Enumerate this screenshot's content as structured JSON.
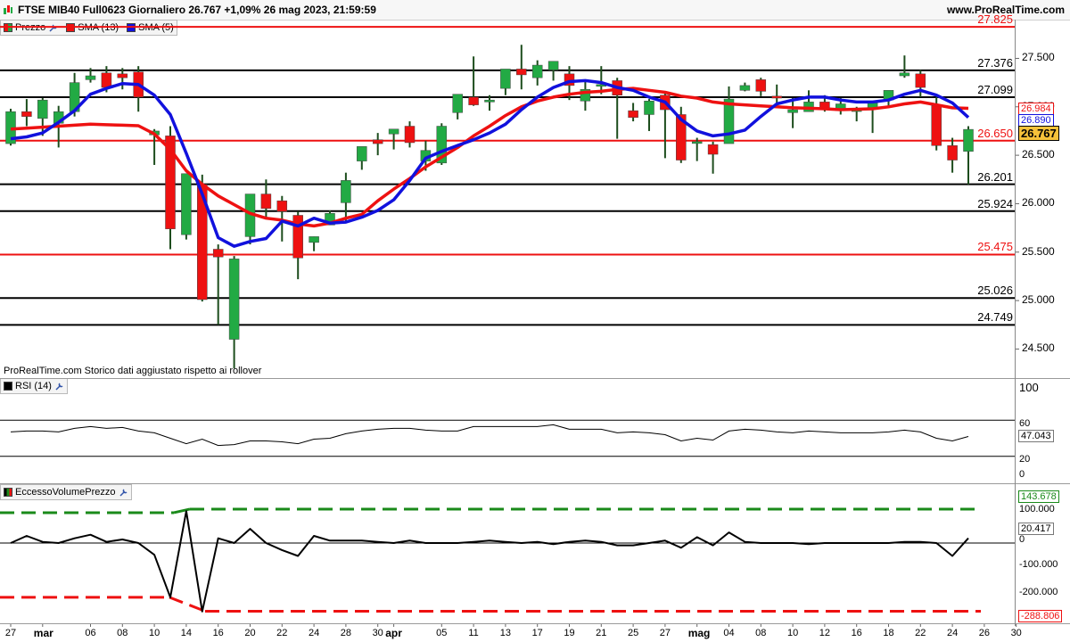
{
  "header": {
    "title": "FTSE MIB40 Full0623 Giornaliero 26.767 +1,09% 26 mag 2023, 21:59:59",
    "site": "www.ProRealTime.com"
  },
  "legend_price": {
    "prezzo": "Prezzo",
    "sma13": "SMA (13)",
    "sma5": "SMA (5)"
  },
  "note": "ProRealTime.com Storico dati aggiustato rispetto ai rollover",
  "rsi": {
    "label": "RSI (14)",
    "value_label": "47.043",
    "ticks": [
      "100",
      "60",
      "20",
      "0"
    ]
  },
  "evp": {
    "label": "EccessoVolumePrezzo",
    "upper_label": "143.678",
    "value_label": "20.417",
    "zero_label": "0",
    "lower_label": "-288.806",
    "ticks": [
      "100.000",
      "-100.000",
      "-200.000"
    ]
  },
  "colors": {
    "up": "#22aa44",
    "down": "#ee1111",
    "sma13": "#ee1111",
    "sma5": "#1111dd",
    "green_dash": "#1a8a1a",
    "red_dash": "#ee1111"
  },
  "chart_data": {
    "type": "candlestick",
    "price_axis": {
      "ylim": [
        24200,
        27900
      ],
      "ticks": [
        "27.500",
        "27.000",
        "26.500",
        "26.000",
        "25.500",
        "25.000",
        "24.500"
      ]
    },
    "levels": [
      {
        "value": 27825,
        "label": "27.825",
        "color": "#ee1111"
      },
      {
        "value": 27376,
        "label": "27.376",
        "color": "#000000"
      },
      {
        "value": 27099,
        "label": "27.099",
        "color": "#000000"
      },
      {
        "value": 26650,
        "label": "26.650",
        "color": "#ee1111"
      },
      {
        "value": 26201,
        "label": "26.201",
        "color": "#000000"
      },
      {
        "value": 25924,
        "label": "25.924",
        "color": "#000000"
      },
      {
        "value": 25475,
        "label": "25.475",
        "color": "#ee1111"
      },
      {
        "value": 25026,
        "label": "25.026",
        "color": "#000000"
      },
      {
        "value": 24749,
        "label": "24.749",
        "color": "#000000"
      }
    ],
    "last_price": {
      "value": 26767,
      "label": "26.767"
    },
    "sma13_last": {
      "value": 26984,
      "label": "26.984"
    },
    "sma5_last": {
      "value": 26890,
      "label": "26.890"
    },
    "x_labels": [
      {
        "label": "27",
        "i": 0,
        "bold": false
      },
      {
        "label": "mar",
        "i": 2,
        "bold": true
      },
      {
        "label": "06",
        "i": 5,
        "bold": false
      },
      {
        "label": "08",
        "i": 7,
        "bold": false
      },
      {
        "label": "10",
        "i": 9,
        "bold": false
      },
      {
        "label": "14",
        "i": 11,
        "bold": false
      },
      {
        "label": "16",
        "i": 13,
        "bold": false
      },
      {
        "label": "20",
        "i": 15,
        "bold": false
      },
      {
        "label": "22",
        "i": 17,
        "bold": false
      },
      {
        "label": "24",
        "i": 19,
        "bold": false
      },
      {
        "label": "28",
        "i": 21,
        "bold": false
      },
      {
        "label": "30",
        "i": 23,
        "bold": false
      },
      {
        "label": "apr",
        "i": 24,
        "bold": true
      },
      {
        "label": "05",
        "i": 27,
        "bold": false
      },
      {
        "label": "11",
        "i": 29,
        "bold": false
      },
      {
        "label": "13",
        "i": 31,
        "bold": false
      },
      {
        "label": "17",
        "i": 33,
        "bold": false
      },
      {
        "label": "19",
        "i": 35,
        "bold": false
      },
      {
        "label": "21",
        "i": 37,
        "bold": false
      },
      {
        "label": "25",
        "i": 39,
        "bold": false
      },
      {
        "label": "27",
        "i": 41,
        "bold": false
      },
      {
        "label": "mag",
        "i": 43,
        "bold": true
      },
      {
        "label": "04",
        "i": 45,
        "bold": false
      },
      {
        "label": "08",
        "i": 47,
        "bold": false
      },
      {
        "label": "10",
        "i": 49,
        "bold": false
      },
      {
        "label": "12",
        "i": 51,
        "bold": false
      },
      {
        "label": "16",
        "i": 53,
        "bold": false
      },
      {
        "label": "18",
        "i": 55,
        "bold": false
      },
      {
        "label": "22",
        "i": 57,
        "bold": false
      },
      {
        "label": "24",
        "i": 59,
        "bold": false
      },
      {
        "label": "26",
        "i": 61,
        "bold": false
      },
      {
        "label": "30",
        "i": 63,
        "bold": false
      }
    ],
    "candles": [
      [
        26620,
        26980,
        26600,
        26950
      ],
      [
        26950,
        27080,
        26800,
        26900
      ],
      [
        26880,
        27090,
        26700,
        27070
      ],
      [
        26830,
        27010,
        26580,
        26950
      ],
      [
        26950,
        27350,
        26900,
        27250
      ],
      [
        27280,
        27400,
        27250,
        27320
      ],
      [
        27350,
        27420,
        27150,
        27200
      ],
      [
        27340,
        27400,
        27180,
        27300
      ],
      [
        27360,
        27420,
        26950,
        27100
      ],
      [
        26710,
        26770,
        26400,
        26750
      ],
      [
        26700,
        26800,
        25530,
        25740
      ],
      [
        25680,
        26270,
        25630,
        26310
      ],
      [
        26200,
        26300,
        24990,
        25010
      ],
      [
        25530,
        25580,
        24750,
        25450
      ],
      [
        24600,
        25460,
        24300,
        25430
      ],
      [
        25660,
        26090,
        25580,
        26100
      ],
      [
        26100,
        26250,
        25850,
        25950
      ],
      [
        26030,
        26080,
        25610,
        25920
      ],
      [
        25880,
        25920,
        25220,
        25440
      ],
      [
        25600,
        25660,
        25510,
        25660
      ],
      [
        25780,
        25930,
        25780,
        25900
      ],
      [
        26010,
        26320,
        25820,
        26240
      ],
      [
        26440,
        26560,
        26350,
        26590
      ],
      [
        26660,
        26730,
        26500,
        26620
      ],
      [
        26720,
        26760,
        26560,
        26770
      ],
      [
        26800,
        26850,
        26580,
        26630
      ],
      [
        26440,
        26650,
        26340,
        26550
      ],
      [
        26420,
        26830,
        26400,
        26800
      ],
      [
        26940,
        27120,
        26870,
        27130
      ],
      [
        27100,
        27520,
        27010,
        27020
      ],
      [
        27050,
        27120,
        26960,
        27070
      ],
      [
        27190,
        27350,
        27120,
        27390
      ],
      [
        27390,
        27640,
        27180,
        27330
      ],
      [
        27300,
        27480,
        27220,
        27430
      ],
      [
        27380,
        27470,
        27270,
        27470
      ],
      [
        27340,
        27420,
        27070,
        27220
      ],
      [
        27060,
        27280,
        26960,
        27180
      ],
      [
        27220,
        27420,
        27130,
        27230
      ],
      [
        27270,
        27300,
        26670,
        27120
      ],
      [
        26960,
        27040,
        26850,
        26890
      ],
      [
        26920,
        27080,
        26750,
        27060
      ],
      [
        27120,
        27150,
        26470,
        26970
      ],
      [
        26920,
        27000,
        26420,
        26450
      ],
      [
        26640,
        26680,
        26440,
        26640
      ],
      [
        26610,
        26640,
        26310,
        26510
      ],
      [
        26620,
        27210,
        26630,
        27080
      ],
      [
        27170,
        27250,
        27160,
        27220
      ],
      [
        27280,
        27300,
        27110,
        27160
      ],
      [
        27110,
        27230,
        26990,
        27090
      ],
      [
        26940,
        27090,
        26780,
        26970
      ],
      [
        26950,
        27170,
        26950,
        27050
      ],
      [
        27050,
        27120,
        26950,
        26990
      ],
      [
        26960,
        27090,
        26920,
        27030
      ],
      [
        26960,
        27000,
        26850,
        26970
      ],
      [
        26980,
        27060,
        26730,
        27040
      ],
      [
        27070,
        27130,
        26990,
        27170
      ],
      [
        27320,
        27530,
        27300,
        27350
      ],
      [
        27340,
        27380,
        27100,
        27200
      ],
      [
        27010,
        27100,
        26550,
        26600
      ],
      [
        26600,
        26680,
        26320,
        26450
      ],
      [
        26540,
        26800,
        26200,
        26767
      ]
    ],
    "sma13": [
      26770,
      26780,
      26790,
      26800,
      26810,
      26820,
      26815,
      26810,
      26805,
      26720,
      26560,
      26340,
      26200,
      26080,
      25990,
      25900,
      25850,
      25830,
      25790,
      25770,
      25800,
      25850,
      25890,
      26030,
      26150,
      26260,
      26380,
      26480,
      26580,
      26700,
      26800,
      26910,
      27000,
      27060,
      27100,
      27130,
      27150,
      27160,
      27180,
      27190,
      27170,
      27150,
      27110,
      27090,
      27050,
      27030,
      27020,
      27010,
      27000,
      26990,
      26985,
      26980,
      26970,
      26975,
      26980,
      27000,
      27030,
      27050,
      27020,
      26990,
      26984
    ],
    "sma5": [
      26670,
      26690,
      26730,
      26840,
      26960,
      27130,
      27190,
      27240,
      27230,
      27120,
      26920,
      26520,
      26100,
      25650,
      25560,
      25610,
      25640,
      25820,
      25770,
      25850,
      25800,
      25810,
      25860,
      25930,
      26040,
      26240,
      26470,
      26540,
      26600,
      26660,
      26730,
      26820,
      26970,
      27100,
      27200,
      27260,
      27270,
      27250,
      27200,
      27170,
      27100,
      27050,
      26870,
      26750,
      26700,
      26720,
      26760,
      26900,
      27030,
      27070,
      27100,
      27100,
      27070,
      27050,
      27050,
      27070,
      27130,
      27170,
      27120,
      27040,
      26890
    ],
    "rsi_axis": {
      "ylim": [
        0,
        100
      ],
      "levels": [
        70,
        30
      ]
    },
    "rsi": [
      57,
      58,
      58,
      57,
      61,
      63,
      61,
      62,
      58,
      56,
      50,
      44,
      49,
      42,
      43,
      47,
      47,
      46,
      44,
      49,
      50,
      55,
      58,
      60,
      61,
      61,
      59,
      58,
      58,
      63,
      63,
      63,
      63,
      63,
      65,
      60,
      60,
      60,
      56,
      57,
      56,
      54,
      47,
      50,
      48,
      58,
      60,
      59,
      57,
      56,
      58,
      57,
      56,
      56,
      56,
      57,
      59,
      57,
      50,
      47,
      52
    ],
    "evp_axis": {
      "ylim": [
        -340000,
        185000
      ],
      "upper": 143678,
      "lower": -288806
    },
    "evp": [
      0,
      30000,
      5000,
      0,
      20000,
      35000,
      5000,
      15000,
      0,
      -50000,
      -230000,
      135000,
      -290000,
      20000,
      0,
      60000,
      0,
      -30000,
      -55000,
      30000,
      10000,
      10000,
      10000,
      5000,
      0,
      10000,
      0,
      0,
      0,
      5000,
      10000,
      5000,
      0,
      5000,
      -5000,
      5000,
      10000,
      5000,
      -10000,
      -10000,
      0,
      10000,
      -20000,
      25000,
      -10000,
      45000,
      5000,
      0,
      0,
      0,
      -5000,
      0,
      0,
      0,
      0,
      0,
      5000,
      5000,
      0,
      -55000,
      20417
    ]
  }
}
